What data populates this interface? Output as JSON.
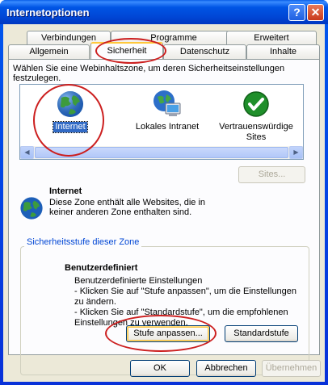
{
  "window": {
    "title": "Internetoptionen",
    "help_glyph": "?",
    "close_glyph": "✕"
  },
  "tabs": {
    "back_row": [
      "Verbindungen",
      "Programme",
      "Erweitert"
    ],
    "front_row": [
      "Allgemein",
      "Sicherheit",
      "Datenschutz",
      "Inhalte"
    ],
    "active": "Sicherheit"
  },
  "zones": {
    "prompt": "Wählen Sie eine Webinhaltszone, um deren Sicherheitseinstellungen festzulegen.",
    "items": [
      {
        "label": "Internet",
        "icon": "globe-icon",
        "selected": true
      },
      {
        "label": "Lokales Intranet",
        "icon": "intranet-icon",
        "selected": false
      },
      {
        "label": "Vertrauenswürdige Sites",
        "icon": "checkmark-icon",
        "selected": false
      }
    ]
  },
  "selected_zone": {
    "name": "Internet",
    "description": "Diese Zone enthält alle Websites, die in keiner anderen Zone enthalten sind.",
    "sites_button": "Sites..."
  },
  "security_level": {
    "group_title": "Sicherheitsstufe dieser Zone",
    "level_name": "Benutzerdefiniert",
    "description_lines": [
      "Benutzerdefinierte Einstellungen",
      "- Klicken Sie auf \"Stufe anpassen\", um die Einstellungen zu ändern.",
      "- Klicken Sie auf \"Standardstufe\", um die empfohlenen Einstellungen zu verwenden."
    ],
    "custom_button": "Stufe anpassen...",
    "default_button": "Standardstufe"
  },
  "footer": {
    "ok": "OK",
    "cancel": "Abbrechen",
    "apply": "Übernehmen"
  },
  "colors": {
    "annotation": "#cc1f1f",
    "selection": "#316ac5",
    "title_bar": "#0055e5"
  }
}
